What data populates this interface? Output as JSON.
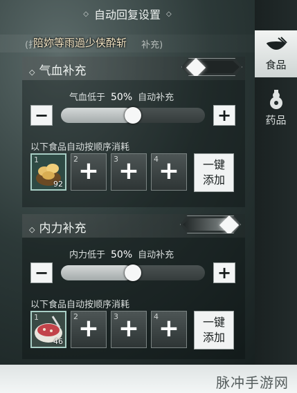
{
  "header": {
    "title": "自动回复设置"
  },
  "notice": {
    "back_text": "(打",
    "back_suffix": "补充)",
    "front_text": "陪妳等雨過少侠酔斩"
  },
  "tabs": [
    {
      "label": "食品",
      "icon": "food-bowl-icon",
      "active": true
    },
    {
      "label": "药品",
      "icon": "medicine-gourd-icon",
      "active": false
    }
  ],
  "hp_section": {
    "title": "气血补充",
    "toggle_on": false,
    "threshold_prefix": "气血低于",
    "threshold_value": "50%",
    "threshold_suffix": "自动补充",
    "slider_percent": 50,
    "queue_label": "以下食品自动按顺序消耗",
    "slots": [
      {
        "num": "1",
        "filled": true,
        "count": "92",
        "item_icon": "buns-basket-icon"
      },
      {
        "num": "2",
        "filled": false
      },
      {
        "num": "3",
        "filled": false
      },
      {
        "num": "4",
        "filled": false
      }
    ],
    "onekey_line1": "一键",
    "onekey_line2": "添加"
  },
  "mp_section": {
    "title": "内力补充",
    "toggle_on": true,
    "threshold_prefix": "内力低于",
    "threshold_value": "50%",
    "threshold_suffix": "自动补充",
    "slider_percent": 50,
    "queue_label": "以下食品自动按顺序消耗",
    "slots": [
      {
        "num": "1",
        "filled": true,
        "count": "46",
        "item_icon": "soup-bowl-icon"
      },
      {
        "num": "2",
        "filled": false
      },
      {
        "num": "3",
        "filled": false
      },
      {
        "num": "4",
        "filled": false
      }
    ],
    "onekey_line1": "一键",
    "onekey_line2": "添加"
  },
  "minus_symbol": "−",
  "plus_symbol": "+",
  "watermark": "脉冲手游网"
}
